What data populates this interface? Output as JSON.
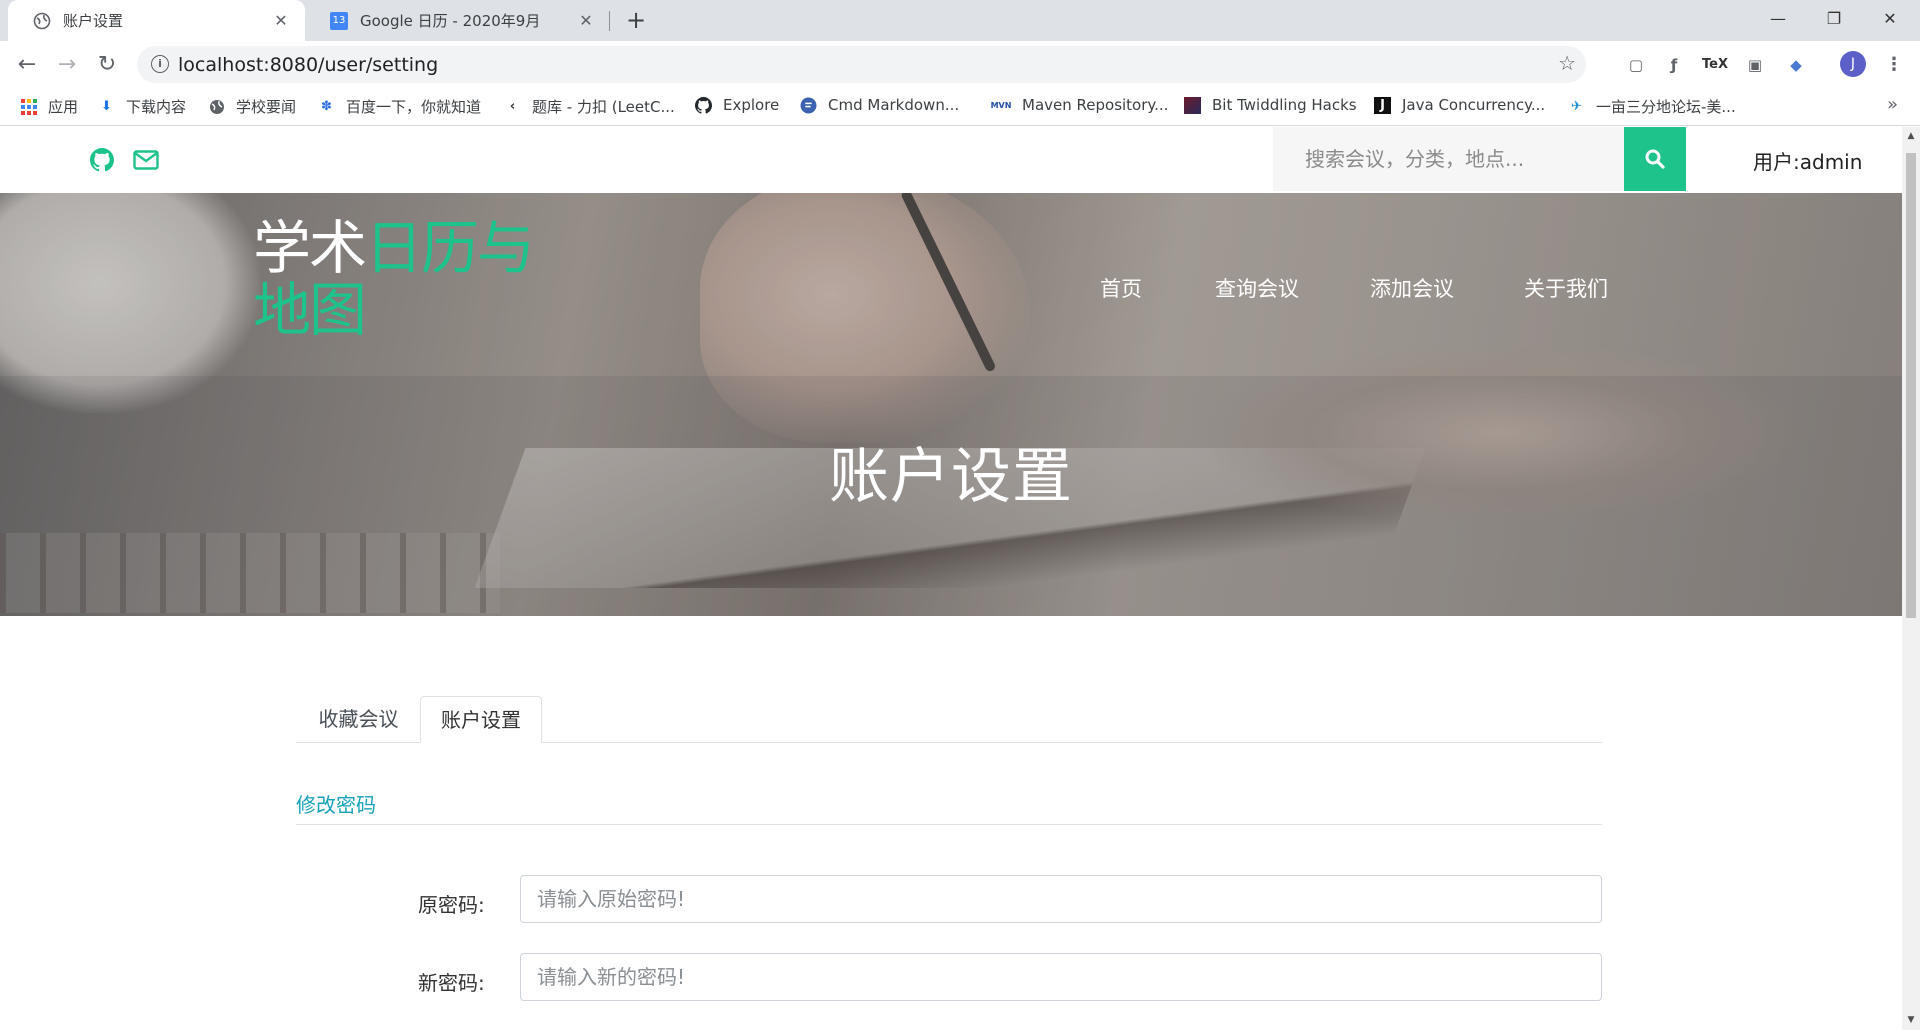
{
  "browser": {
    "tabs": [
      {
        "title": "账户设置",
        "active": true,
        "icon": "globe-icon"
      },
      {
        "title": "Google 日历 - 2020年9月",
        "active": false,
        "icon": "calendar-icon",
        "icon_text": "13"
      }
    ],
    "address": "localhost:8080/user/setting",
    "profile_initial": "J",
    "extensions": [
      "pocket-icon",
      "formula-icon",
      "tex-icon",
      "terminal-icon",
      "mortarboard-icon"
    ],
    "bookmarks": [
      {
        "label": "应用",
        "icon": "apps-grid-icon"
      },
      {
        "label": "下载内容",
        "icon": "download-icon"
      },
      {
        "label": "学校要闻",
        "icon": "globe-icon"
      },
      {
        "label": "百度一下，你就知道",
        "icon": "baidu-paw-icon"
      },
      {
        "label": "题库 - 力扣 (LeetC...",
        "icon": "leetcode-icon"
      },
      {
        "label": "Explore",
        "icon": "github-icon"
      },
      {
        "label": "Cmd Markdown...",
        "icon": "cmd-markdown-icon"
      },
      {
        "label": "Maven Repository...",
        "icon": "maven-icon",
        "icon_text": "MVN"
      },
      {
        "label": "Bit Twiddling Hacks",
        "icon": "bit-twiddling-icon"
      },
      {
        "label": "Java Concurrency...",
        "icon": "java-j-icon",
        "icon_text": "J"
      },
      {
        "label": "一亩三分地论坛-美...",
        "icon": "forum-icon"
      }
    ]
  },
  "site": {
    "search_placeholder": "搜索会议，分类，地点...",
    "user_label": "用户:admin",
    "logo": {
      "white": "学术",
      "green_line1": "日历与",
      "green_line2": "地图"
    },
    "nav": [
      "首页",
      "查询会议",
      "添加会议",
      "关于我们"
    ],
    "hero_title": "账户设置",
    "accent_color": "#1ec28b",
    "tabs": [
      {
        "label": "收藏会议",
        "active": false
      },
      {
        "label": "账户设置",
        "active": true
      }
    ],
    "section_title": "修改密码",
    "form": [
      {
        "label": "原密码:",
        "placeholder": "请输入原始密码!"
      },
      {
        "label": "新密码:",
        "placeholder": "请输入新的密码!"
      }
    ]
  }
}
